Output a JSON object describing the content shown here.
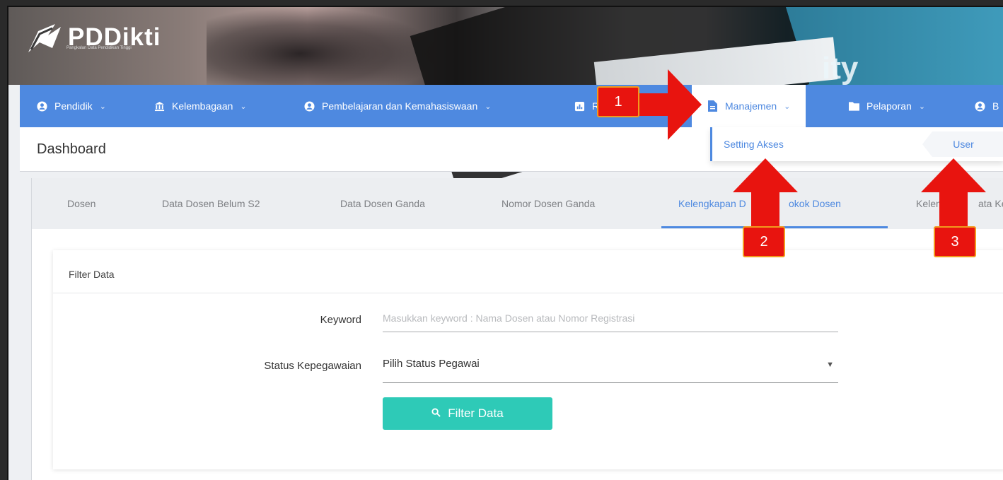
{
  "brand": {
    "name": "PDDikti",
    "tagline": "Pangkalan Data Pendidikan Tinggi"
  },
  "banner": {
    "partial_text": "ity"
  },
  "nav": {
    "items": [
      {
        "label": "Pendidik",
        "icon": "user-circle-icon"
      },
      {
        "label": "Kelembagaan",
        "icon": "institution-icon"
      },
      {
        "label": "Pembelajaran dan Kemahasiswaan",
        "icon": "user-circle-icon"
      },
      {
        "label": "R",
        "icon": "chart-icon"
      },
      {
        "label": "Manajemen",
        "icon": "document-icon",
        "active": true
      },
      {
        "label": "Pelaporan",
        "icon": "folder-icon"
      },
      {
        "label": "B",
        "icon": "user-circle-icon"
      }
    ]
  },
  "dropdown": {
    "items": [
      "Setting Akses",
      "User"
    ]
  },
  "page": {
    "title": "Dashboard"
  },
  "tabs": [
    "Dosen",
    "Data Dosen Belum S2",
    "Data Dosen Ganda",
    "Nomor Dosen Ganda",
    "Kelengkapan D",
    "okok Dosen",
    "Kelengk",
    "ata Ke"
  ],
  "filter": {
    "title": "Filter Data",
    "keyword_label": "Keyword",
    "keyword_placeholder": "Masukkan keyword : Nama Dosen atau Nomor Registrasi",
    "status_label": "Status Kepegawaian",
    "status_value": "Pilih Status Pegawai",
    "button_label": "Filter Data"
  },
  "annotations": [
    "1",
    "2",
    "3"
  ],
  "colors": {
    "nav": "#4e89e0",
    "button": "#2ecab7",
    "annotation": "#e8140f"
  }
}
